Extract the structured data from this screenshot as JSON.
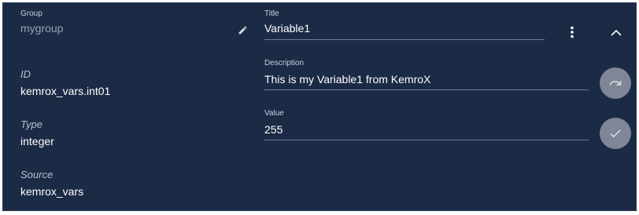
{
  "group": {
    "label": "Group",
    "value": "mygroup"
  },
  "title": {
    "label": "Title",
    "value": "Variable1"
  },
  "id": {
    "label": "ID",
    "value": "kemrox_vars.int01"
  },
  "type": {
    "label": "Type",
    "value": "integer"
  },
  "source": {
    "label": "Source",
    "value": "kemrox_vars"
  },
  "description": {
    "label": "Description",
    "value": "This is my Variable1 from KemroX"
  },
  "value": {
    "label": "Value",
    "value": "255"
  },
  "icons": {
    "edit": "pencil-icon",
    "menu": "more-vert-icon",
    "collapse": "chevron-up-icon",
    "undo": "undo-icon",
    "confirm": "check-icon"
  },
  "colors": {
    "panel_bg": "#1b2a45",
    "button_bg": "#7f8695",
    "underline": "#6f7d93"
  }
}
